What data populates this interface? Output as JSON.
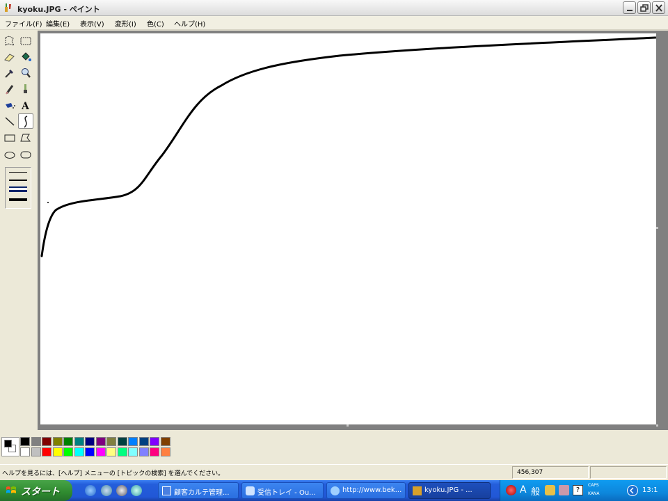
{
  "window": {
    "title": "kyoku.JPG - ペイント",
    "buttons": {
      "minimize": "minimize",
      "maximize": "restore",
      "close": "close"
    }
  },
  "menu": {
    "items": [
      "ファイル(F)",
      "編集(E)",
      "表示(V)",
      "変形(I)",
      "色(C)",
      "ヘルプ(H)"
    ]
  },
  "toolbox": {
    "tools": [
      "free-select",
      "rect-select",
      "eraser",
      "fill",
      "eyedropper",
      "magnifier",
      "pencil",
      "brush",
      "airbrush",
      "text",
      "line",
      "curve",
      "rectangle",
      "polygon",
      "ellipse",
      "rounded-rectangle"
    ],
    "selected_tool": "curve",
    "line_widths": 4,
    "selected_line_width": 3
  },
  "palette": {
    "foreground": "#000000",
    "background": "#ffffff",
    "row1": [
      "#000000",
      "#808080",
      "#800000",
      "#808000",
      "#008000",
      "#008080",
      "#000080",
      "#800080",
      "#808040",
      "#004040",
      "#0080ff",
      "#004080",
      "#8000ff",
      "#804000"
    ],
    "row2": [
      "#ffffff",
      "#c0c0c0",
      "#ff0000",
      "#ffff00",
      "#00ff00",
      "#00ffff",
      "#0000ff",
      "#ff00ff",
      "#ffff80",
      "#00ff80",
      "#80ffff",
      "#8080ff",
      "#ff0080",
      "#ff8040"
    ]
  },
  "status": {
    "help_text": "ヘルプを見るには、[ヘルプ] メニューの [トピックの検索] を選んでください。",
    "coordinates": "456,307"
  },
  "taskbar": {
    "start_label": "スタート",
    "tasks": [
      {
        "label": "顧客カルテ管理...",
        "active": false
      },
      {
        "label": "受信トレイ - Ou...",
        "active": false
      },
      {
        "label": "http://www.bek...",
        "active": false
      },
      {
        "label": "kyoku.JPG - ...",
        "active": true
      }
    ],
    "tray": {
      "ime_mode": "A",
      "ime_kanji": "般",
      "caps": "CAPS",
      "kana": "KANA",
      "clock": "13:1"
    }
  }
}
